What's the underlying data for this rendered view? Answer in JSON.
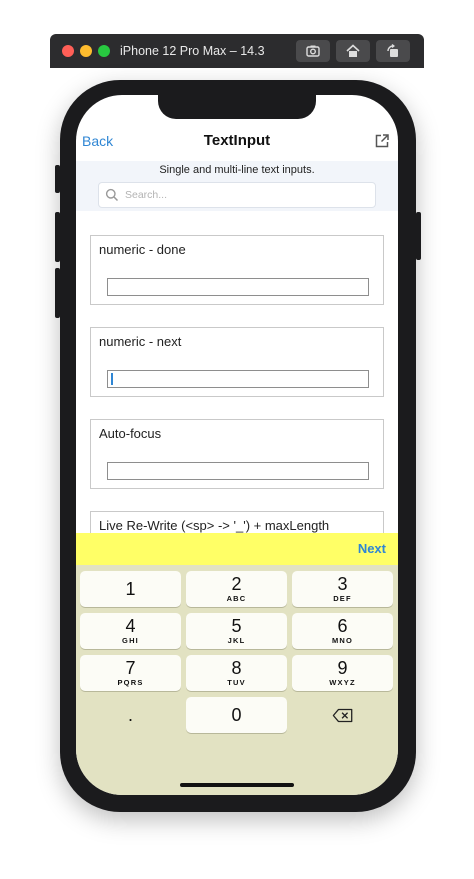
{
  "simulator": {
    "title": "iPhone 12 Pro Max – 14.3",
    "buttons": [
      "screenshot-icon",
      "home-icon",
      "rotate-icon"
    ]
  },
  "nav": {
    "back_label": "Back",
    "title": "TextInput",
    "action_icon": "external-link-icon"
  },
  "subtitle": "Single and multi-line text inputs.",
  "search": {
    "placeholder": "Search..."
  },
  "cards": [
    {
      "label": "numeric - done",
      "value": ""
    },
    {
      "label": "numeric - next",
      "value": "",
      "focused": true
    },
    {
      "label": "Auto-focus",
      "value": ""
    },
    {
      "label": "Live Re-Write (<sp>  ->  '_') + maxLength"
    }
  ],
  "accessory": {
    "next_label": "Next",
    "background": "#ffff66"
  },
  "keypad": {
    "keys": [
      {
        "num": "1",
        "letters": ""
      },
      {
        "num": "2",
        "letters": "ABC"
      },
      {
        "num": "3",
        "letters": "DEF"
      },
      {
        "num": "4",
        "letters": "GHI"
      },
      {
        "num": "5",
        "letters": "JKL"
      },
      {
        "num": "6",
        "letters": "MNO"
      },
      {
        "num": "7",
        "letters": "PQRS"
      },
      {
        "num": "8",
        "letters": "TUV"
      },
      {
        "num": "9",
        "letters": "WXYZ"
      },
      {
        "num": ".",
        "letters": ""
      },
      {
        "num": "0",
        "letters": ""
      }
    ],
    "delete_icon": "backspace-icon"
  },
  "colors": {
    "accent": "#2f86d4",
    "keyboard_bg": "#e2e2c2"
  }
}
